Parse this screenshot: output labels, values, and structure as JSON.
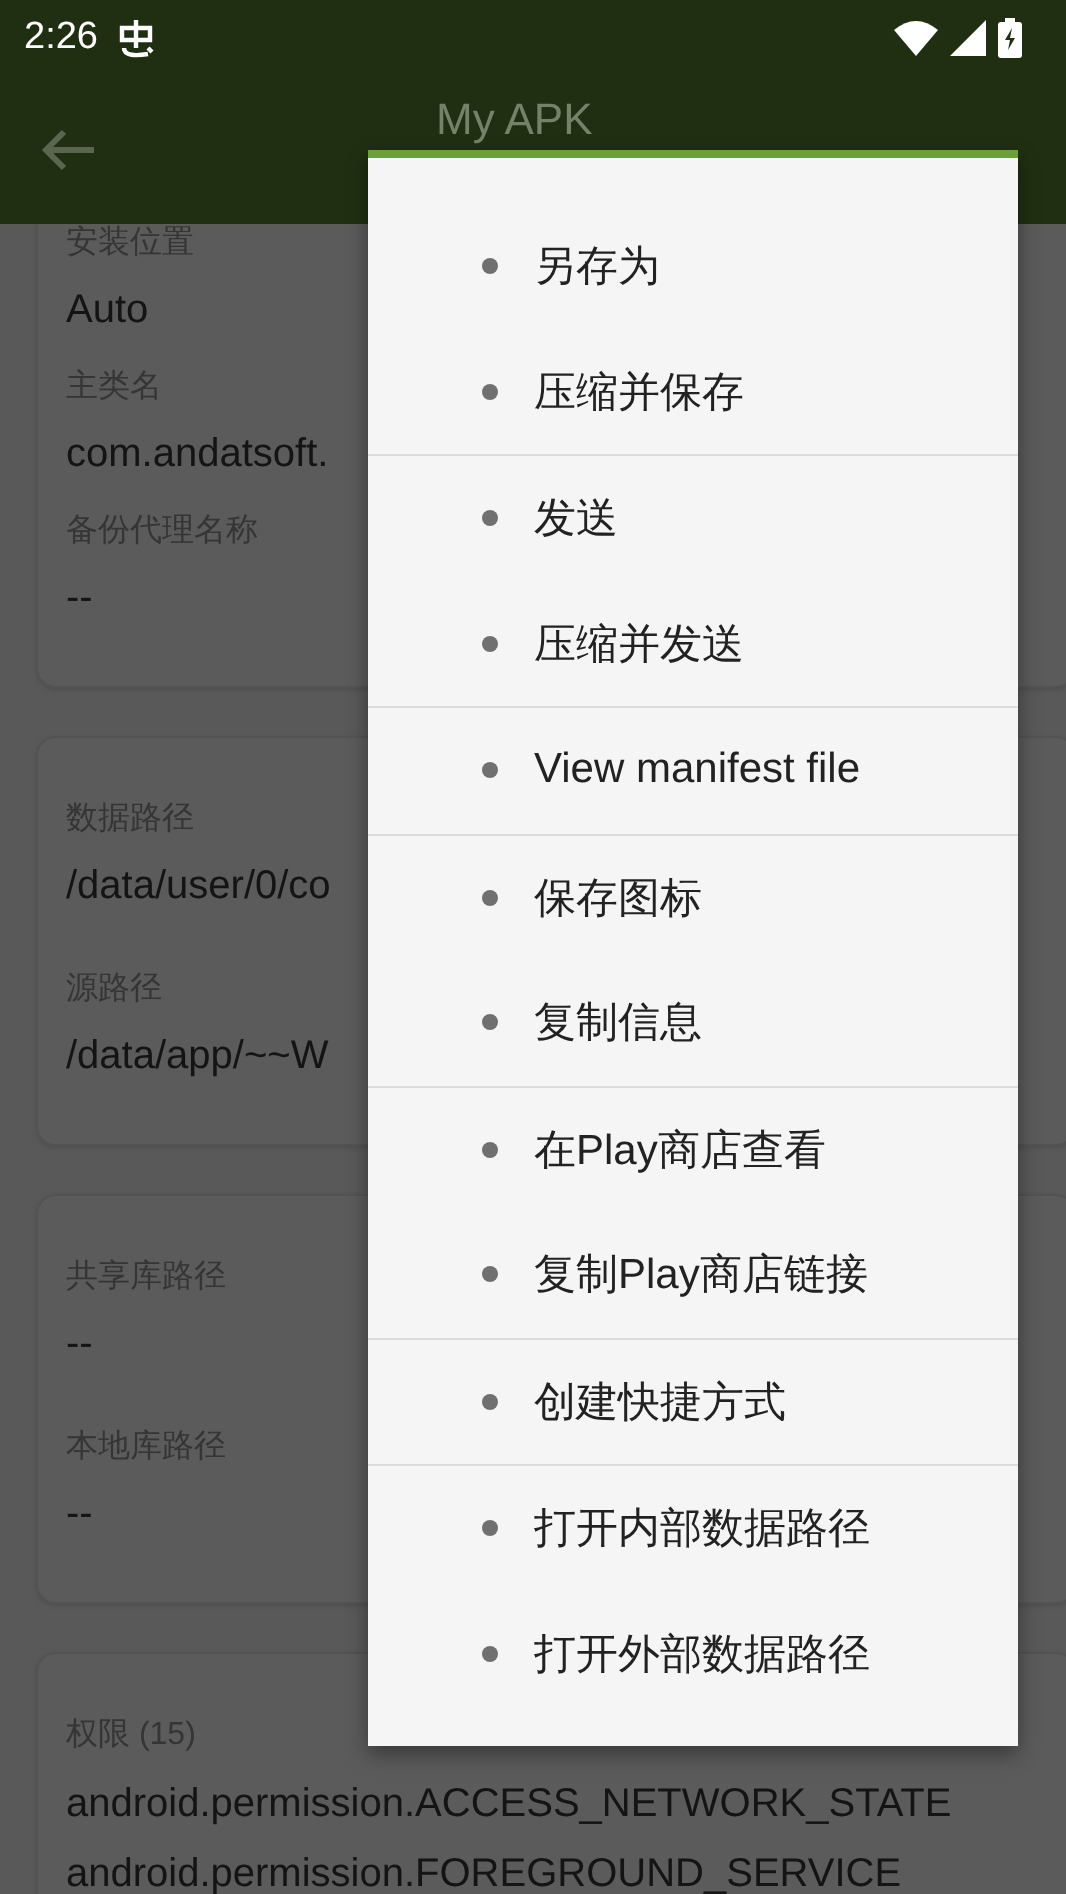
{
  "status_bar": {
    "time": "2:26"
  },
  "app_bar": {
    "title": "My APK"
  },
  "cards": [
    {
      "fields": [
        {
          "label": "安装位置",
          "value": "Auto"
        },
        {
          "label": "主类名",
          "value": "com.andatsoft."
        },
        {
          "label": "备份代理名称",
          "value": "--"
        }
      ]
    },
    {
      "fields": [
        {
          "label": "数据路径",
          "value": "/data/user/0/co"
        },
        {
          "label": "源路径",
          "value": "/data/app/~~W"
        }
      ]
    },
    {
      "fields": [
        {
          "label": "共享库路径",
          "value": "--"
        },
        {
          "label": "本地库路径",
          "value": "--"
        }
      ]
    },
    {
      "fields": [
        {
          "label": "权限 (15)",
          "values": [
            "android.permission.ACCESS_NETWORK_STATE",
            "android.permission.FOREGROUND_SERVICE"
          ]
        }
      ]
    }
  ],
  "menu": {
    "groups": [
      [
        "另存为",
        "压缩并保存"
      ],
      [
        "发送",
        "压缩并发送"
      ],
      [
        "View manifest file"
      ],
      [
        "保存图标",
        "复制信息"
      ],
      [
        "在Play商店查看",
        "复制Play商店链接"
      ],
      [
        "创建快捷方式"
      ],
      [
        "打开内部数据路径",
        "打开外部数据路径"
      ]
    ]
  }
}
